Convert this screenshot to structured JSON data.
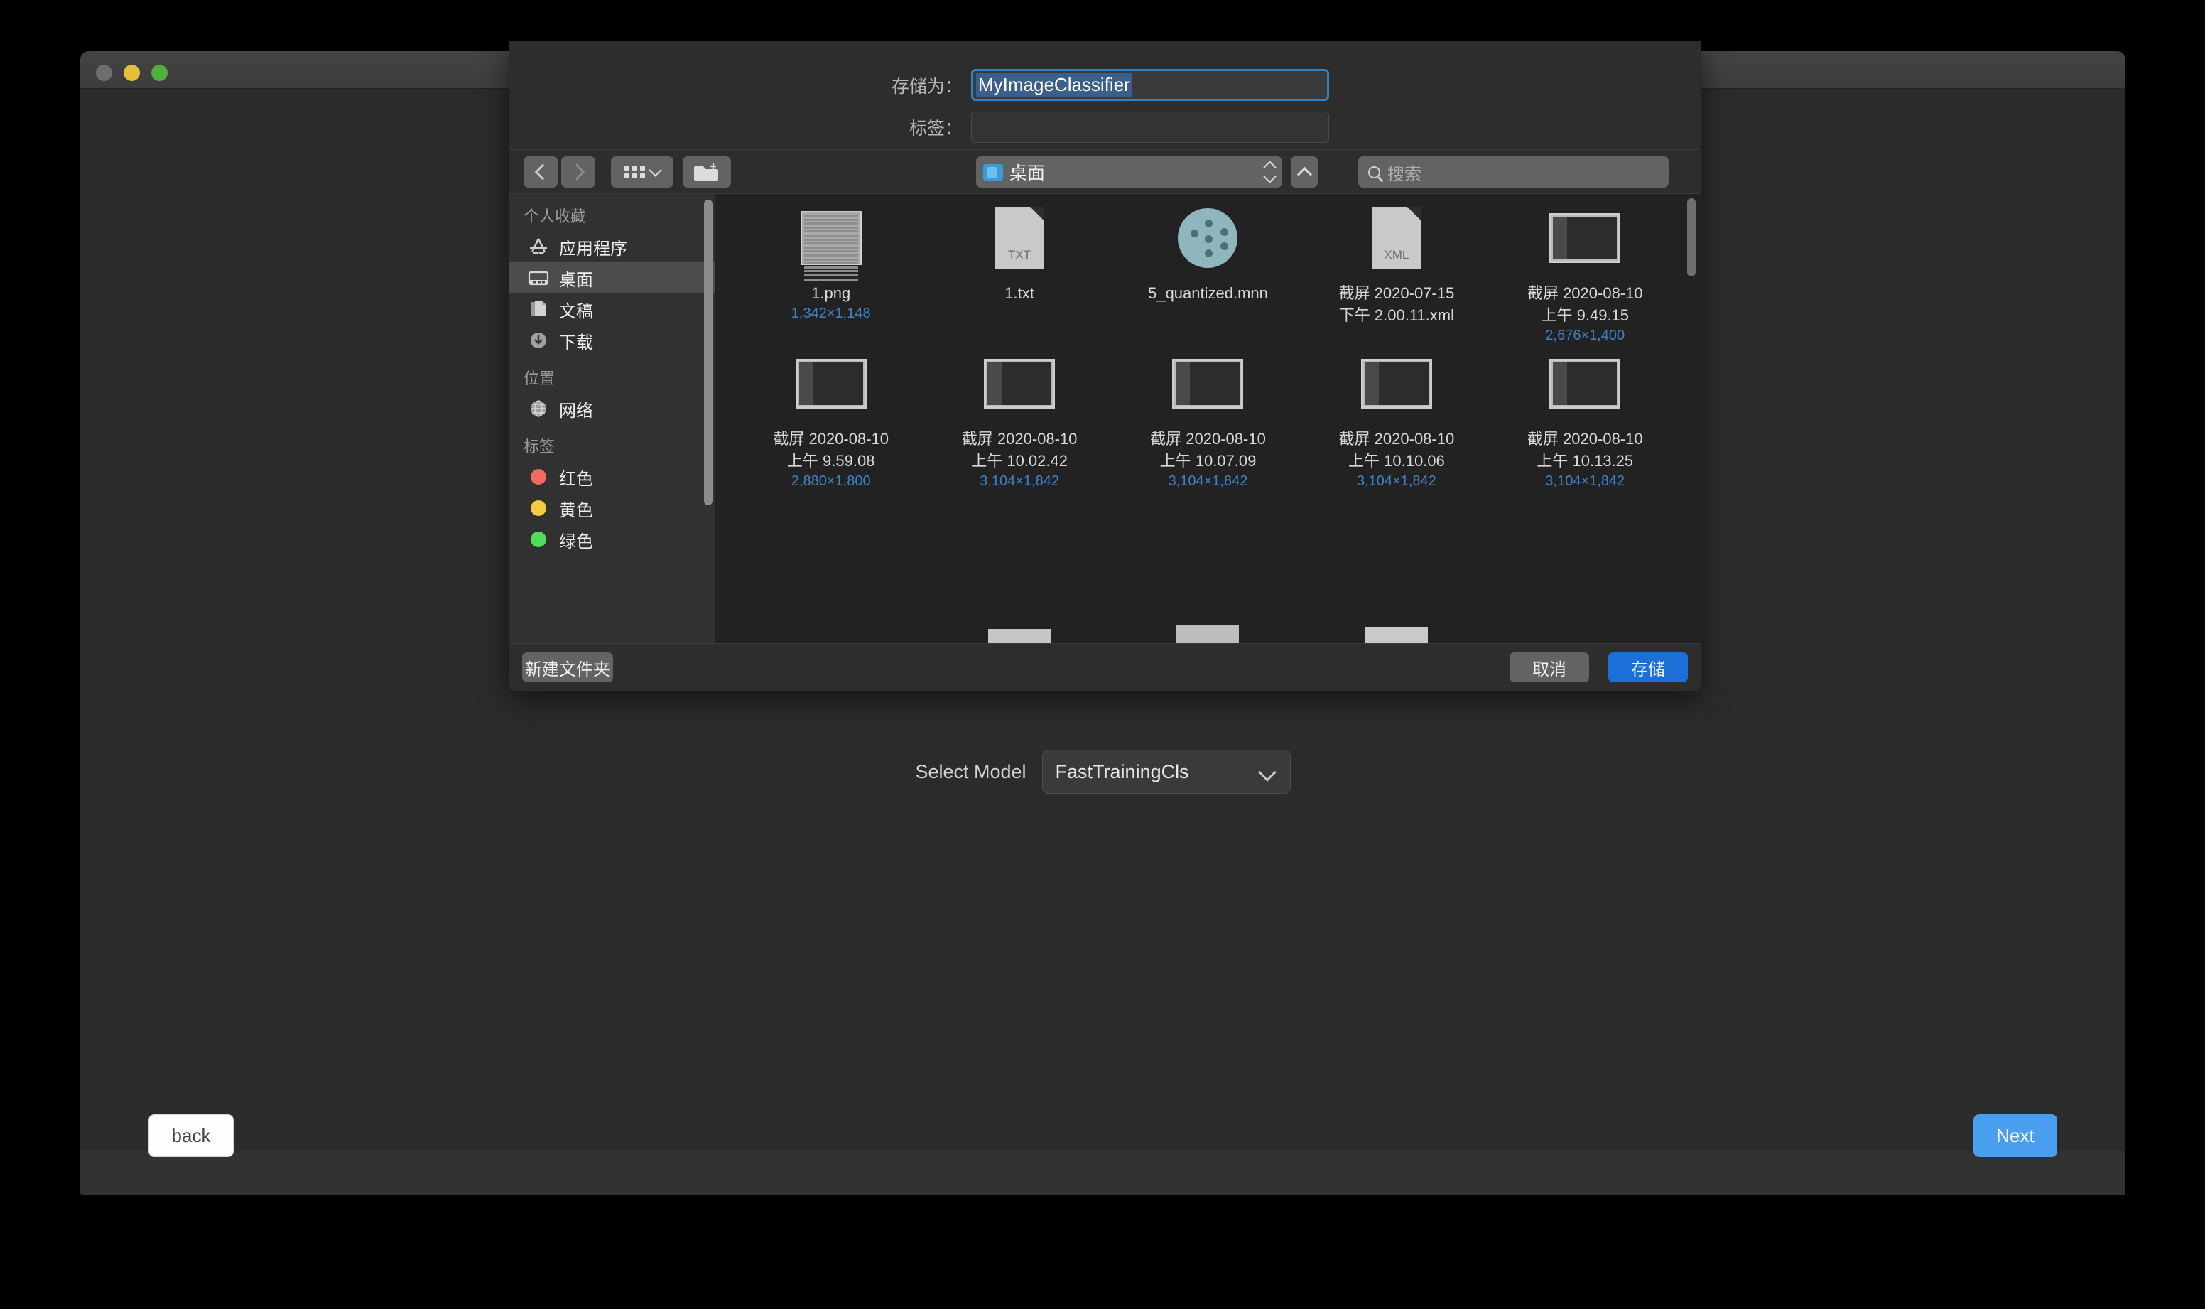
{
  "window": {
    "traffic_lights": [
      {
        "name": "close",
        "color": "#6e6e6e"
      },
      {
        "name": "minimize",
        "color": "#e8bd3c"
      },
      {
        "name": "zoom",
        "color": "#4fb03a"
      }
    ]
  },
  "model_row": {
    "label": "Select Model",
    "selected": "FastTrainingCls",
    "chevron_icon": "chevron-down-icon"
  },
  "footer": {
    "back_label": "back",
    "next_label": "Next",
    "next_color": "#4a9eef"
  },
  "sheet": {
    "fields": {
      "save_as_label": "存储为：",
      "save_as_value": "MyImageClassifier",
      "tags_label": "标签：",
      "tags_value": ""
    },
    "toolbar": {
      "back_icon": "chevron-left-icon",
      "forward_icon": "chevron-right-icon",
      "view_icon": "icon-view-grid-icon",
      "view_chevron_icon": "chevron-down-icon",
      "new_folder_icon": "new-folder-icon",
      "path_label": "桌面",
      "path_folder_icon": "folder-icon",
      "path_stepper_icon": "up-down-stepper-icon",
      "up_icon": "chevron-up-icon",
      "search_icon": "search-icon",
      "search_placeholder": "搜索"
    },
    "sidebar": {
      "sections": [
        {
          "title": "个人收藏",
          "items": [
            {
              "label": "应用程序",
              "icon": "applications-icon",
              "active": false
            },
            {
              "label": "桌面",
              "icon": "desktop-icon",
              "active": true
            },
            {
              "label": "文稿",
              "icon": "documents-icon",
              "active": false
            },
            {
              "label": "下载",
              "icon": "downloads-icon",
              "active": false
            }
          ]
        },
        {
          "title": "位置",
          "items": [
            {
              "label": "网络",
              "icon": "network-globe-icon",
              "active": false
            }
          ]
        },
        {
          "title": "标签",
          "items": [
            {
              "label": "红色",
              "icon": "tag-dot-icon",
              "color": "#f06a60",
              "active": false
            },
            {
              "label": "黄色",
              "icon": "tag-dot-icon",
              "color": "#f5cc3f",
              "active": false
            },
            {
              "label": "绿色",
              "icon": "tag-dot-icon",
              "color": "#4fdd5a",
              "active": false
            }
          ]
        }
      ]
    },
    "files": [
      {
        "name": "1.png",
        "size": "1,342×1,148",
        "kind": "image"
      },
      {
        "name": "1.txt",
        "size": "",
        "kind": "text",
        "badge": "TXT"
      },
      {
        "name": "5_quantized.mnn",
        "size": "",
        "kind": "model"
      },
      {
        "name": "截屏 2020-07-15\n下午 2.00.11.xml",
        "size": "",
        "kind": "xml",
        "badge": "XML"
      },
      {
        "name": "截屏 2020-08-10\n上午 9.49.15",
        "size": "2,676×1,400",
        "kind": "screenshot"
      },
      {
        "name": "截屏 2020-08-10\n上午 9.59.08",
        "size": "2,880×1,800",
        "kind": "screenshot"
      },
      {
        "name": "截屏 2020-08-10\n上午 10.02.42",
        "size": "3,104×1,842",
        "kind": "screenshot"
      },
      {
        "name": "截屏 2020-08-10\n上午 10.07.09",
        "size": "3,104×1,842",
        "kind": "screenshot"
      },
      {
        "name": "截屏 2020-08-10\n上午 10.10.06",
        "size": "3,104×1,842",
        "kind": "screenshot"
      },
      {
        "name": "截屏 2020-08-10\n上午 10.13.25",
        "size": "3,104×1,842",
        "kind": "screenshot"
      }
    ],
    "buttons": {
      "new_folder": "新建文件夹",
      "cancel": "取消",
      "save": "存储",
      "save_color": "#1d6fd8"
    }
  }
}
